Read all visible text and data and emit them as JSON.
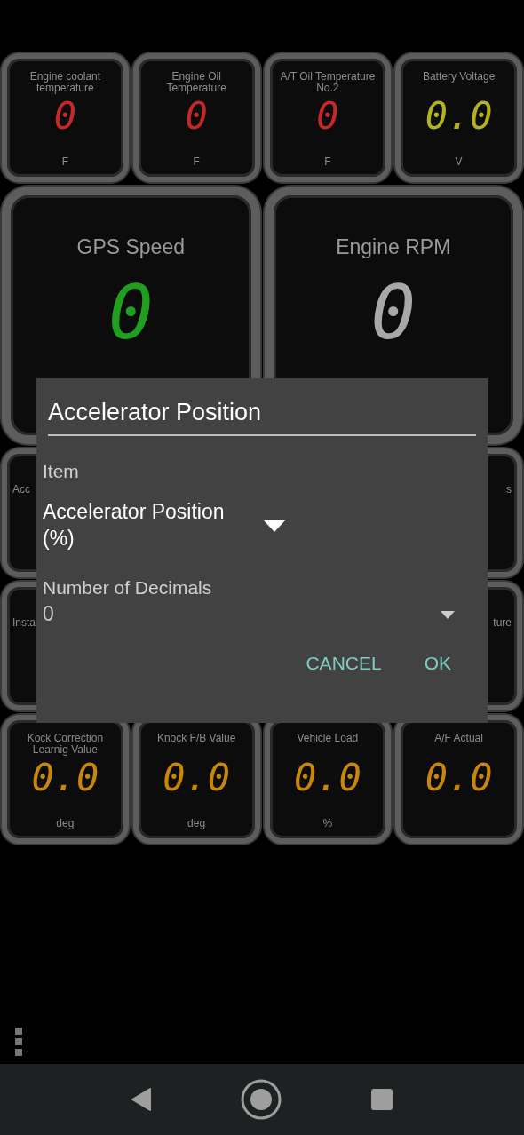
{
  "top_gauges": [
    {
      "title": "Engine coolant temperature",
      "value": "0",
      "unit": "F",
      "color": "#c62828"
    },
    {
      "title": "Engine Oil Temperature",
      "value": "0",
      "unit": "F",
      "color": "#c62828"
    },
    {
      "title": "A/T Oil Temperature No.2",
      "value": "0",
      "unit": "F",
      "color": "#c62828"
    },
    {
      "title": "Battery Voltage",
      "value": "0.0",
      "unit": "V",
      "color": "#b3b320"
    }
  ],
  "large_gauges": [
    {
      "title": "GPS Speed",
      "value": "0",
      "color": "#1f9e1f"
    },
    {
      "title": "Engine RPM",
      "value": "0",
      "color": "#a8a8a8"
    }
  ],
  "partial_gauges": [
    {
      "title": "Acc"
    },
    {
      "title": "s"
    },
    {
      "title": "Insta"
    },
    {
      "title": "ture"
    }
  ],
  "bottom_gauges": [
    {
      "title": "Kock Correction Learnig Value",
      "value": "0.0",
      "unit": "deg",
      "color": "#c8860a"
    },
    {
      "title": "Knock F/B Value",
      "value": "0.0",
      "unit": "deg",
      "color": "#c8860a"
    },
    {
      "title": "Vehicle Load",
      "value": "0.0",
      "unit": "%",
      "color": "#c8860a"
    },
    {
      "title": "A/F Actual",
      "value": "0.0",
      "color": "#c8860a"
    }
  ],
  "dialog": {
    "title_field": "Accelerator Position",
    "item_label": "Item",
    "item_value": "Accelerator Position (%)",
    "decimals_label": "Number of Decimals",
    "decimals_value": "0",
    "buttons": [
      "CANCEL",
      "OK"
    ]
  }
}
